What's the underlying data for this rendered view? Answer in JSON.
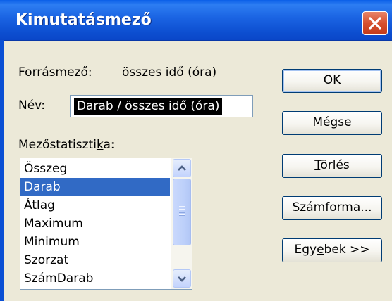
{
  "window": {
    "title": "Kimutatásmező"
  },
  "source": {
    "label": "Forrásmező:",
    "value": "összes idő (óra)"
  },
  "name": {
    "label_underlined": "N",
    "label_rest": "év:",
    "value": "Darab / összes idő (óra)"
  },
  "summarize": {
    "label_pre": "Mezőstatiszti",
    "label_u": "k",
    "label_post": "a:",
    "items": [
      "Összeg",
      "Darab",
      "Átlag",
      "Maximum",
      "Minimum",
      "Szorzat",
      "SzámDarab"
    ],
    "selected": "Darab"
  },
  "buttons": {
    "ok": "OK",
    "cancel": "Mégse",
    "delete_u": "T",
    "delete_rest": "örlés",
    "number_pre": "S",
    "number_u": "z",
    "number_post": "ámforma...",
    "more_pre": "Egy",
    "more_u": "e",
    "more_post": "bek >>"
  },
  "colors": {
    "titlebar": "#0a5fe8",
    "selection": "#316ac5",
    "dialog": "#ece9d8"
  }
}
